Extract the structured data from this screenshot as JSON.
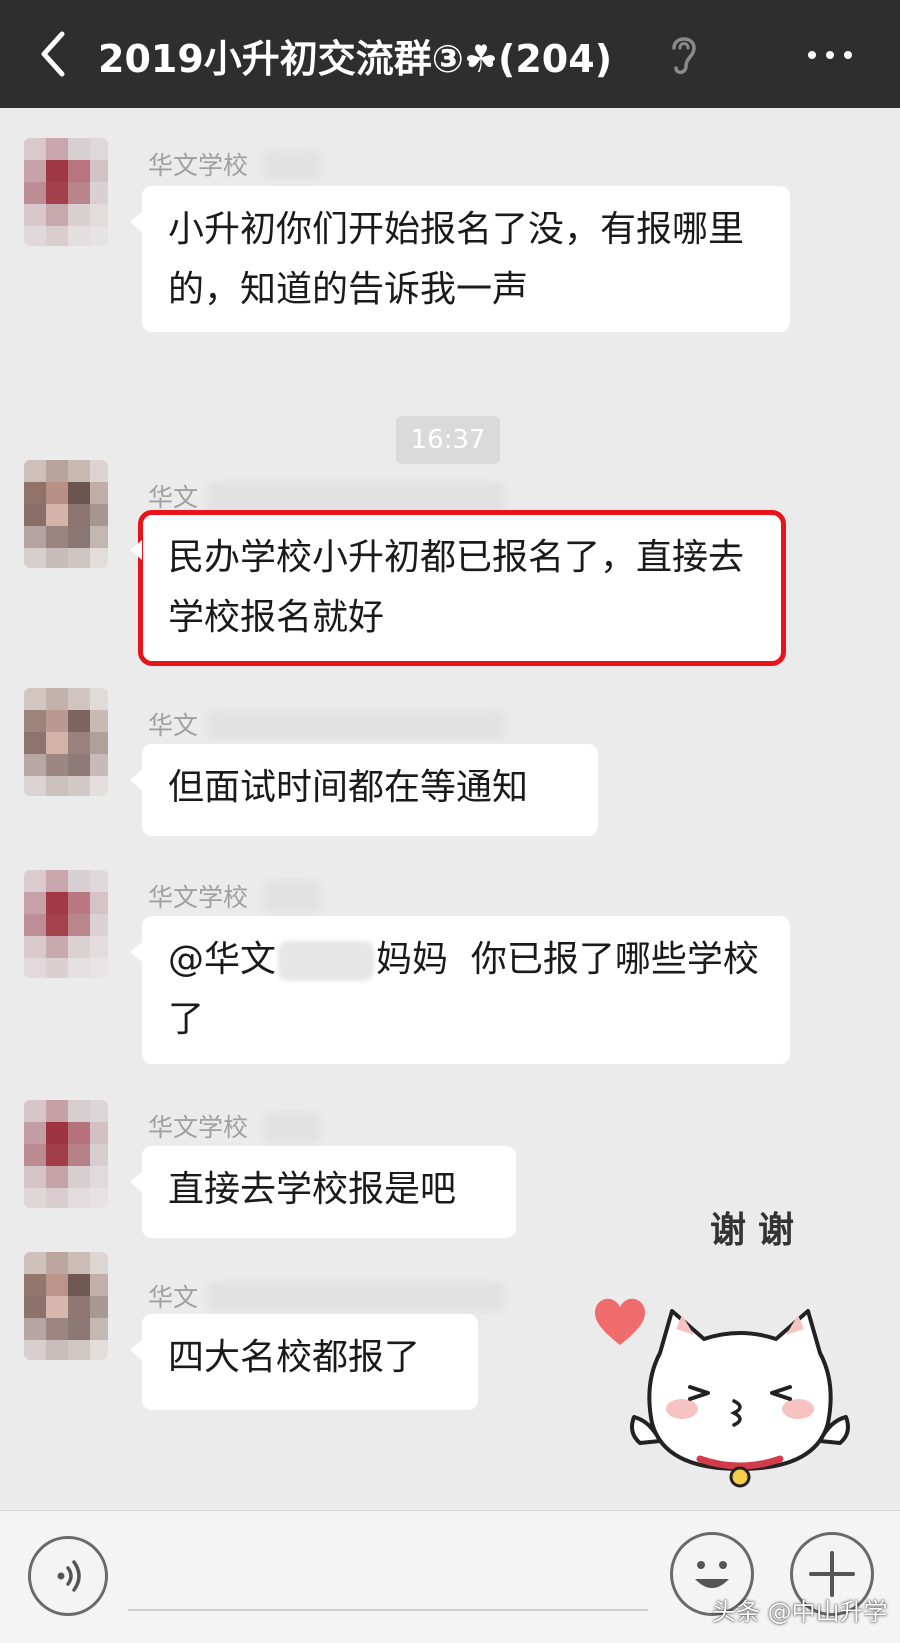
{
  "header": {
    "title": "2019小升初交流群③☘(204)",
    "back_icon": "chevron-left-icon",
    "earpiece_icon": "ear-icon",
    "more_icon": "more-dots-icon"
  },
  "colors": {
    "header_bg": "#2e2e2e",
    "chat_bg": "#ebebeb",
    "bubble_bg": "#ffffff",
    "highlight_border": "#e8141b",
    "sender_text": "#a0a0a0"
  },
  "messages": [
    {
      "sender": "华文学校",
      "text": "小升初你们开始报名了没，有报哪里的，知道的告诉我一声"
    },
    {
      "sender": "华文",
      "text": "民办学校小升初都已报名了，直接去学校报名就好",
      "highlighted": true
    },
    {
      "sender": "华文",
      "text": "但面试时间都在等通知"
    },
    {
      "sender": "华文学校",
      "mention_prefix": "@华文",
      "mention_suffix": "妈妈",
      "text": "你已报了哪些学校了"
    },
    {
      "sender": "华文学校",
      "text": "直接去学校报是吧"
    },
    {
      "sender": "华文",
      "text": "四大名校都报了"
    }
  ],
  "timestamp": "16:37",
  "sticker": {
    "caption": "谢谢",
    "icon": "cat-thanks-sticker"
  },
  "input_bar": {
    "voice_icon": "voice-icon",
    "emoji_icon": "emoji-icon",
    "plus_icon": "plus-icon"
  },
  "watermark": "头条 @中山升学"
}
